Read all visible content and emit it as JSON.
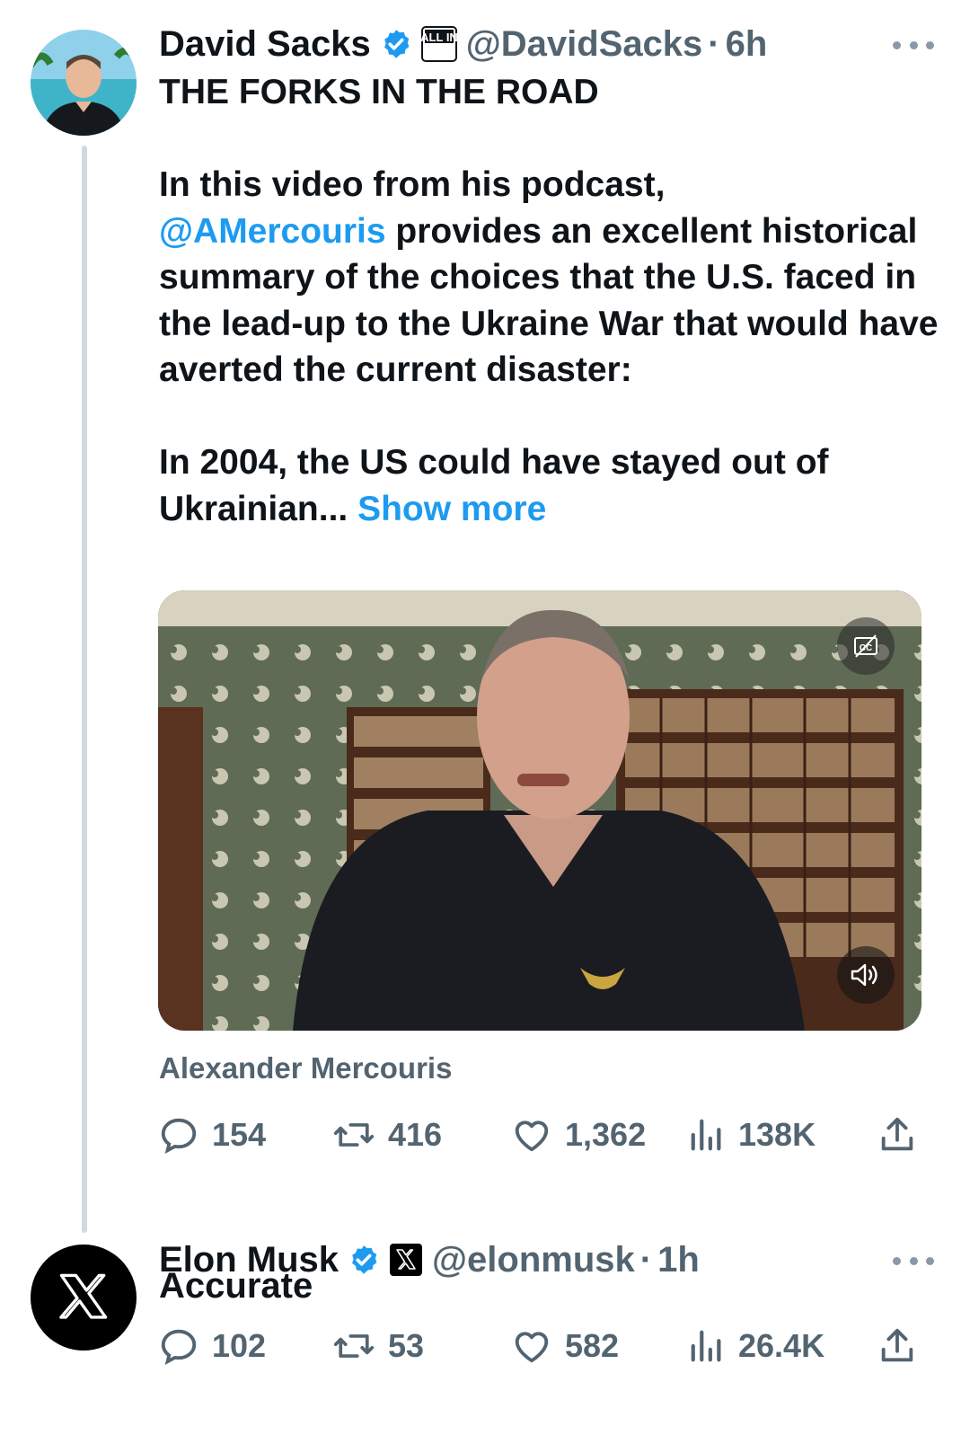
{
  "tweet1": {
    "display_name": "David Sacks",
    "affiliation_badge": "ALL IN",
    "handle": "@DavidSacks",
    "separator": "·",
    "time": "6h",
    "text_title": "THE FORKS IN THE ROAD",
    "text_p1_before": "In this video from his podcast,",
    "mention": "@AMercouris",
    "text_p1_after": " provides an excellent historical summary of the choices that the U.S. faced in the lead-up to the Ukraine War that would have averted the current disaster:",
    "text_p2": "In 2004, the US could have stayed out of Ukrainian...",
    "show_more": "Show more",
    "media_caption": "Alexander Mercouris",
    "replies": "154",
    "reposts": "416",
    "likes": "1,362",
    "views": "138K"
  },
  "tweet2": {
    "display_name": "Elon Musk",
    "handle": "@elonmusk",
    "separator": "·",
    "time": "1h",
    "text": "Accurate",
    "replies": "102",
    "reposts": "53",
    "likes": "582",
    "views": "26.4K"
  },
  "icons": {
    "verified": "verified-badge-icon",
    "more": "more-options-icon",
    "reply": "reply-icon",
    "repost": "repost-icon",
    "like": "heart-icon",
    "views": "views-icon",
    "share": "share-icon",
    "captions": "captions-off-icon",
    "volume": "volume-icon",
    "x_logo": "x-logo-icon"
  },
  "colors": {
    "accent": "#1d9bf0",
    "text": "#0f1419",
    "secondary": "#536471"
  }
}
